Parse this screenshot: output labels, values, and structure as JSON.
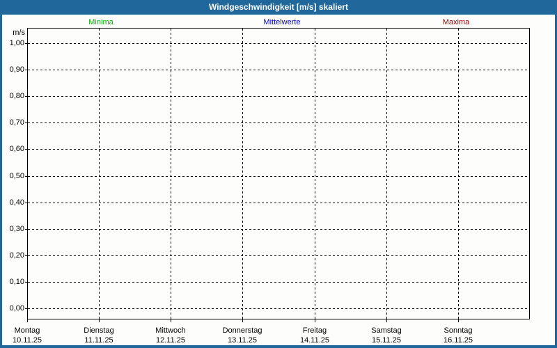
{
  "title": "Windgeschwindigkeit [m/s] skaliert",
  "legend": {
    "minima": {
      "label": "Minima",
      "color": "#00B400"
    },
    "mittelwerte": {
      "label": "Mittelwerte",
      "color": "#0000CC"
    },
    "maxima": {
      "label": "Maxima",
      "color": "#A00000"
    }
  },
  "colors": {
    "titlebar_and_border": "#20689B",
    "title_text": "#FFFFFF",
    "plot_frame": "#000000",
    "gridline": "#000000",
    "background": "#FDFEFB"
  },
  "chart_data": {
    "type": "line",
    "title": "Windgeschwindigkeit [m/s] skaliert",
    "ylabel": "m/s",
    "xlabel": "",
    "ylim": [
      0.0,
      1.0
    ],
    "y_tick_step": 0.1,
    "y_tick_labels_top_down": [
      "1,00",
      "0,90",
      "0,80",
      "0,70",
      "0,60",
      "0,50",
      "0,40",
      "0,30",
      "0,20",
      "0,10",
      "0,00"
    ],
    "x_categories": [
      {
        "day": "Montag",
        "date": "10.11.25"
      },
      {
        "day": "Dienstag",
        "date": "11.11.25"
      },
      {
        "day": "Mittwoch",
        "date": "12.11.25"
      },
      {
        "day": "Donnerstag",
        "date": "13.11.25"
      },
      {
        "day": "Freitag",
        "date": "14.11.25"
      },
      {
        "day": "Samstag",
        "date": "15.11.25"
      },
      {
        "day": "Sonntag",
        "date": "16.11.25"
      }
    ],
    "grid": "dashed",
    "legend_position": "top",
    "series": [
      {
        "name": "Minima",
        "color": "#00B400",
        "values": []
      },
      {
        "name": "Mittelwerte",
        "color": "#0000CC",
        "values": []
      },
      {
        "name": "Maxima",
        "color": "#A00000",
        "values": []
      }
    ]
  }
}
